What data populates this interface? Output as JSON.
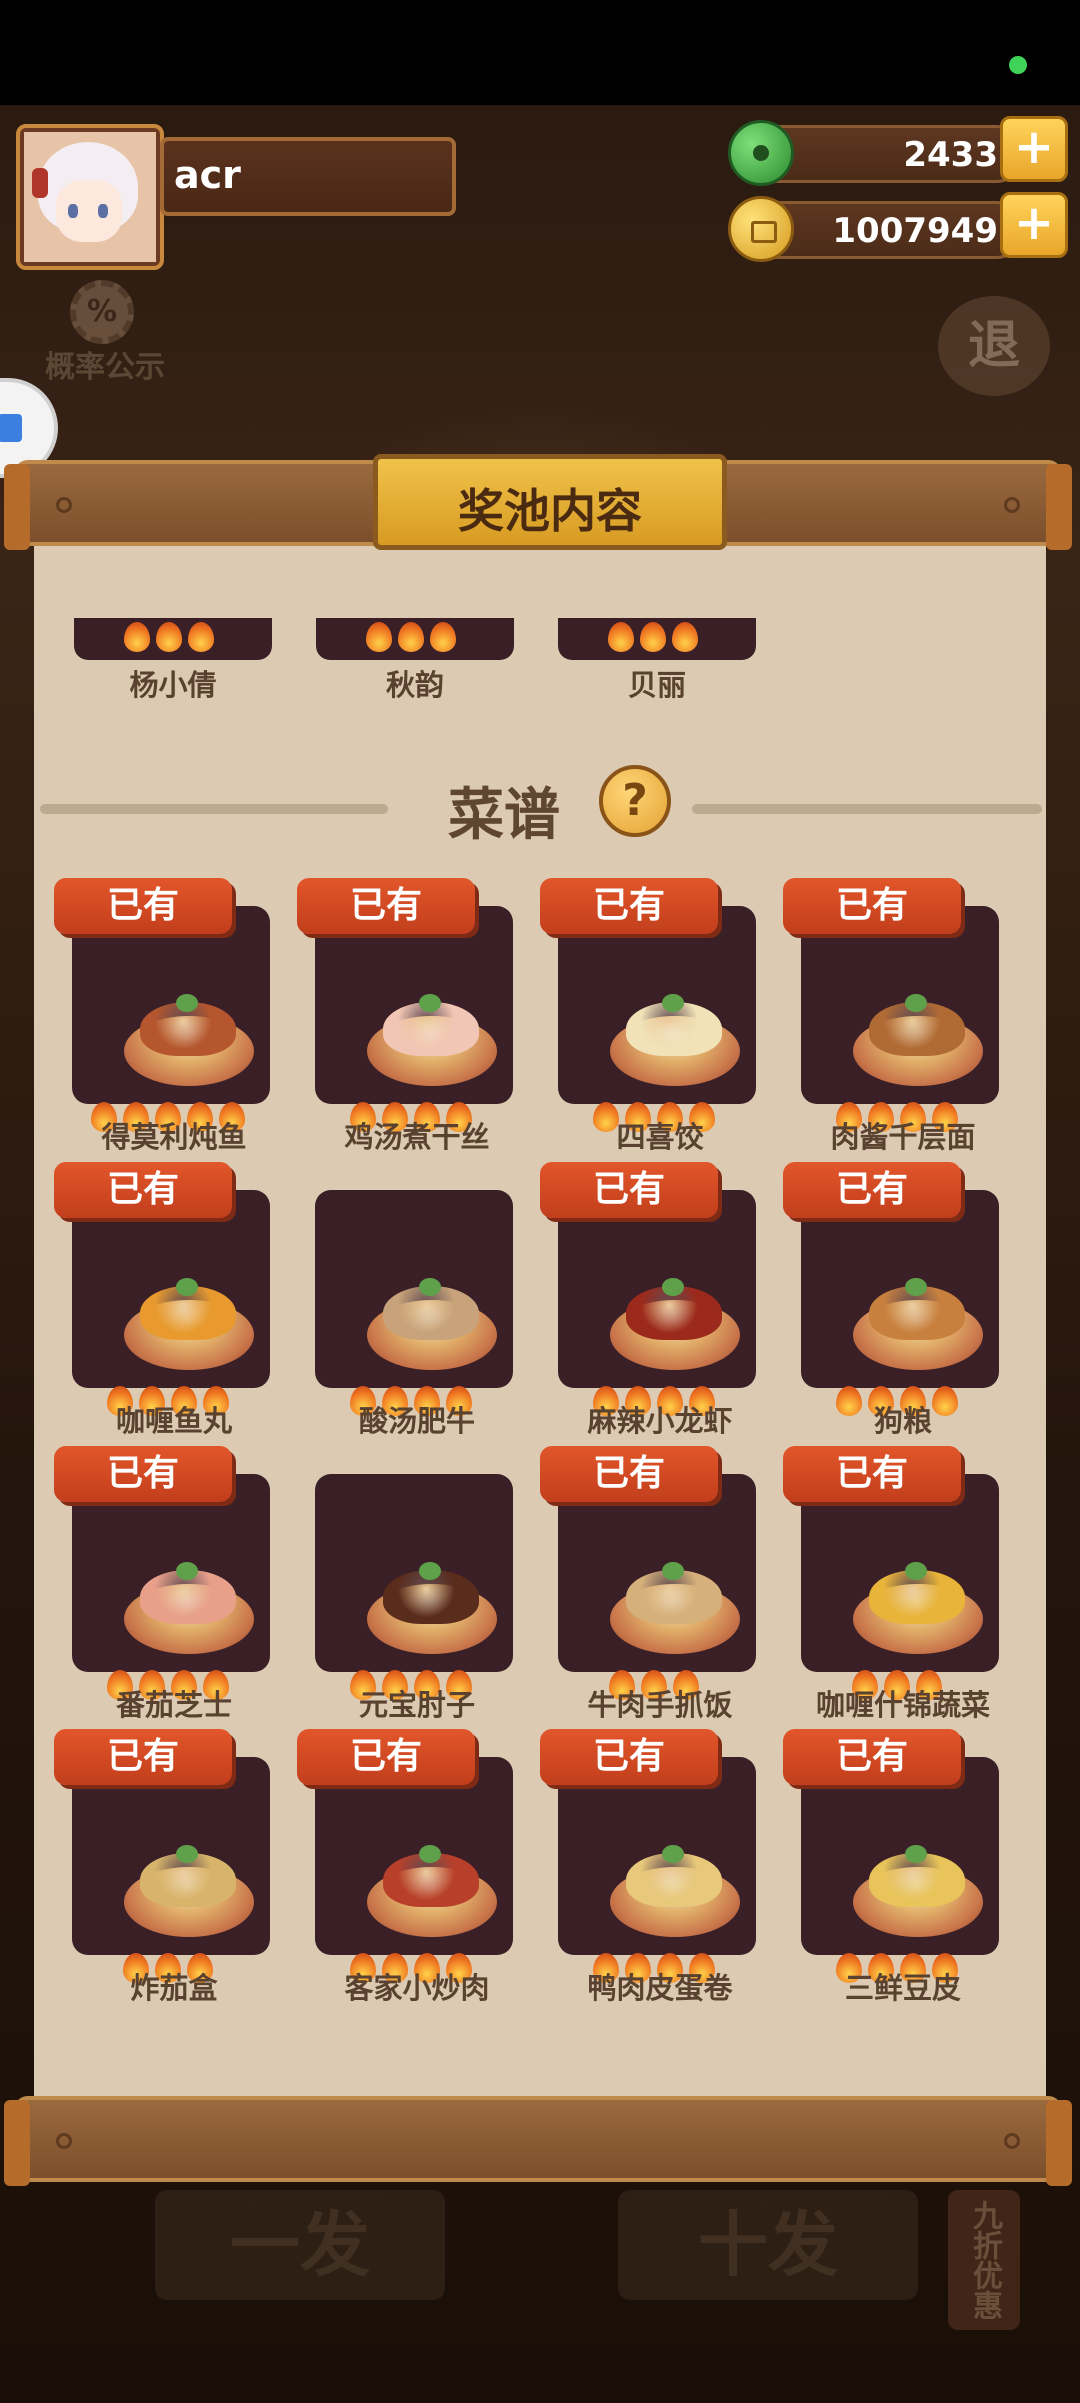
{
  "player": {
    "name": "acr"
  },
  "currency": {
    "jade": "2433",
    "coins": "1007949"
  },
  "side_menu": {
    "probability_label": "概率公示",
    "probability_symbol": "%",
    "exit_label": "退"
  },
  "panel": {
    "title": "奖池内容"
  },
  "characters": [
    "杨小倩",
    "秋韵",
    "贝丽"
  ],
  "section": {
    "title": "菜谱",
    "help_symbol": "?"
  },
  "owned_label": "已有",
  "recipes": [
    {
      "name": "得莫利炖鱼",
      "owned": true,
      "stars": 5,
      "color": "#b5562e"
    },
    {
      "name": "鸡汤煮干丝",
      "owned": true,
      "stars": 4,
      "color": "#f2c6b4"
    },
    {
      "name": "四喜饺",
      "owned": true,
      "stars": 4,
      "color": "#f1e2b8"
    },
    {
      "name": "肉酱千层面",
      "owned": true,
      "stars": 4,
      "color": "#b06a34"
    },
    {
      "name": "咖喱鱼丸",
      "owned": true,
      "stars": 4,
      "color": "#e89a2e"
    },
    {
      "name": "酸汤肥牛",
      "owned": false,
      "stars": 4,
      "color": "#c8a27a"
    },
    {
      "name": "麻辣小龙虾",
      "owned": true,
      "stars": 4,
      "color": "#9c2a1c"
    },
    {
      "name": "狗粮",
      "owned": true,
      "stars": 4,
      "color": "#c8803e"
    },
    {
      "name": "番茄芝士",
      "owned": true,
      "stars": 4,
      "color": "#e8a08a"
    },
    {
      "name": "元宝肘子",
      "owned": false,
      "stars": 4,
      "color": "#5a2c1c"
    },
    {
      "name": "牛肉手抓饭",
      "owned": true,
      "stars": 3,
      "color": "#d6b07a"
    },
    {
      "name": "咖喱什锦蔬菜",
      "owned": true,
      "stars": 3,
      "color": "#e8b43a"
    },
    {
      "name": "炸茄盒",
      "owned": true,
      "stars": 3,
      "color": "#d8b46a"
    },
    {
      "name": "客家小炒肉",
      "owned": true,
      "stars": 4,
      "color": "#b8402a"
    },
    {
      "name": "鸭肉皮蛋卷",
      "owned": true,
      "stars": 4,
      "color": "#e8c87a"
    },
    {
      "name": "三鲜豆皮",
      "owned": true,
      "stars": 4,
      "color": "#e8c45a"
    }
  ],
  "bottom": {
    "single_draw": "一发",
    "ten_draw": "十发",
    "discount": "九折优惠"
  }
}
